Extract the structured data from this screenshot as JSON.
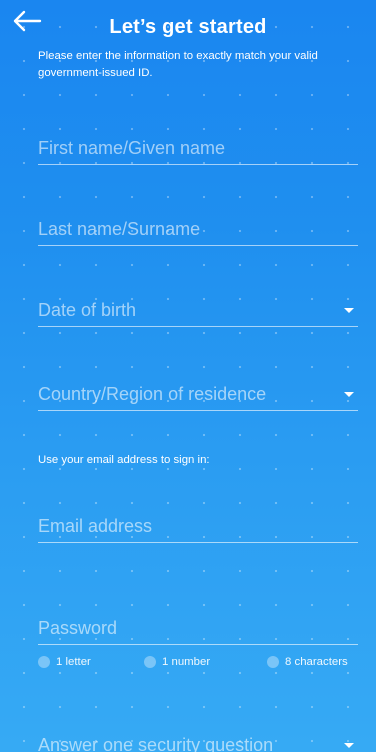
{
  "header": {
    "title": "Let’s get started",
    "back_icon": "arrow-left-icon"
  },
  "subtitle": "Please enter the information to exactly match your valid government-issued ID.",
  "fields": {
    "first_name": {
      "placeholder": "First name/Given name",
      "value": ""
    },
    "last_name": {
      "placeholder": "Last name/Surname",
      "value": ""
    },
    "date_of_birth": {
      "label": "Date of birth",
      "icon": "caret-down-icon"
    },
    "country": {
      "label": "Country/Region of residence",
      "icon": "caret-down-icon"
    },
    "email": {
      "placeholder": "Email address",
      "value": ""
    },
    "password": {
      "placeholder": "Password",
      "value": ""
    },
    "security_question": {
      "label": "Answer one security question",
      "icon": "caret-down-icon"
    }
  },
  "email_section_label": "Use your email address to sign in:",
  "password_requirements": [
    {
      "label": "1 letter",
      "met": false,
      "icon": "check-circle-icon"
    },
    {
      "label": "1 number",
      "met": false,
      "icon": "check-circle-icon"
    },
    {
      "label": "8 characters",
      "met": false,
      "icon": "check-circle-icon"
    }
  ],
  "colors": {
    "background_top": "#1a86f0",
    "background_bottom": "#36aaf4",
    "text": "#ffffff"
  }
}
